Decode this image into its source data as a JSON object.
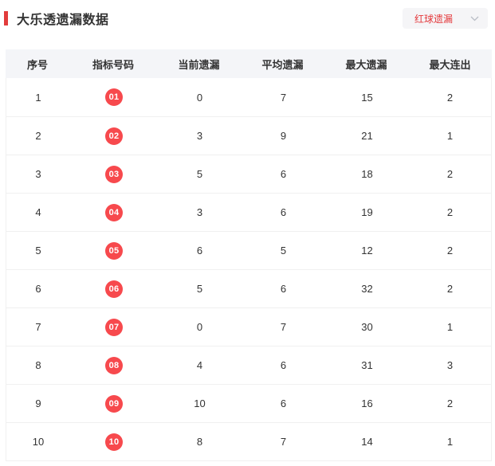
{
  "page": {
    "title": "大乐透遗漏数据"
  },
  "colors": {
    "accent": "#e23c3c",
    "ball": "#f7494d",
    "dropdown_text": "#e4393c",
    "header_bg": "#f4f5f8",
    "border": "#f0f0f0"
  },
  "filter_dropdown": {
    "selected": "红球遗漏",
    "chevron_icon": "chevron-down"
  },
  "table": {
    "headers": [
      "序号",
      "指标号码",
      "当前遗漏",
      "平均遗漏",
      "最大遗漏",
      "最大连出"
    ],
    "rows": [
      {
        "index": 1,
        "ball": "01",
        "current": 0,
        "average": 7,
        "max_miss": 15,
        "max_streak": 2
      },
      {
        "index": 2,
        "ball": "02",
        "current": 3,
        "average": 9,
        "max_miss": 21,
        "max_streak": 1
      },
      {
        "index": 3,
        "ball": "03",
        "current": 5,
        "average": 6,
        "max_miss": 18,
        "max_streak": 2
      },
      {
        "index": 4,
        "ball": "04",
        "current": 3,
        "average": 6,
        "max_miss": 19,
        "max_streak": 2
      },
      {
        "index": 5,
        "ball": "05",
        "current": 6,
        "average": 5,
        "max_miss": 12,
        "max_streak": 2
      },
      {
        "index": 6,
        "ball": "06",
        "current": 5,
        "average": 6,
        "max_miss": 32,
        "max_streak": 2
      },
      {
        "index": 7,
        "ball": "07",
        "current": 0,
        "average": 7,
        "max_miss": 30,
        "max_streak": 1
      },
      {
        "index": 8,
        "ball": "08",
        "current": 4,
        "average": 6,
        "max_miss": 31,
        "max_streak": 3
      },
      {
        "index": 9,
        "ball": "09",
        "current": 10,
        "average": 6,
        "max_miss": 16,
        "max_streak": 2
      },
      {
        "index": 10,
        "ball": "10",
        "current": 8,
        "average": 7,
        "max_miss": 14,
        "max_streak": 1
      }
    ]
  }
}
